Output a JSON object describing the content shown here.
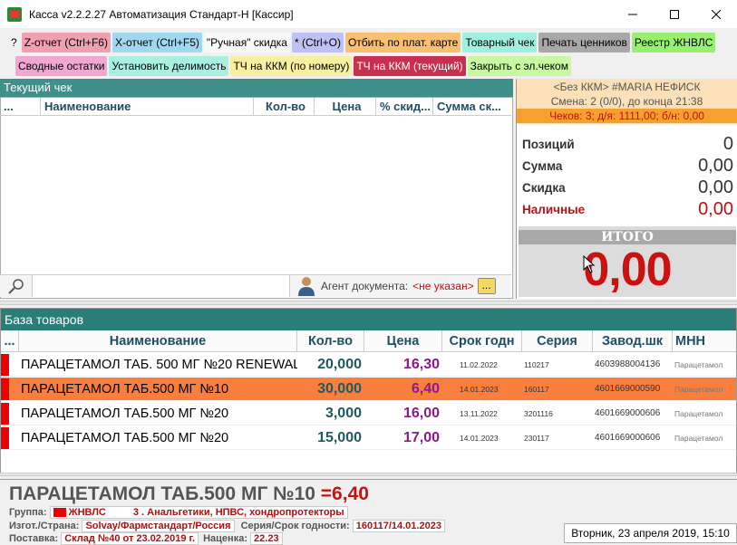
{
  "window": {
    "title": "Касса v2.2.2.27 Автоматизация Стандарт-Н [Кассир]",
    "min": "—",
    "max": "☐",
    "close": "✕"
  },
  "toolbar": {
    "row1": [
      {
        "label": "?",
        "color": "#f0f0f0"
      },
      {
        "label": "Z-отчет (Ctrl+F6)",
        "color": "#f0a0b0"
      },
      {
        "label": "X-отчет (Ctrl+F5)",
        "color": "#a0d8f0"
      },
      {
        "label": "\"Ручная\" скидка",
        "color": "#f8f8f8"
      },
      {
        "label": "* (Ctrl+O)",
        "color": "#c0c0f8"
      },
      {
        "label": "Отбить по плат. карте",
        "color": "#f8c070"
      },
      {
        "label": "Товарный чек",
        "color": "#a0f0e0"
      },
      {
        "label": "Печать ценников",
        "color": "#a8a8a8"
      },
      {
        "label": "Реестр ЖНВЛС",
        "color": "#98f070"
      }
    ],
    "row2": [
      {
        "label": "Сводные остатки",
        "color": "#f0a8d0"
      },
      {
        "label": "Установить делимость",
        "color": "#a8f0e0"
      },
      {
        "label": "ТЧ на ККМ (по номеру)",
        "color": "#f8f0a0"
      },
      {
        "label": "ТЧ на ККМ (текущий)",
        "color": "#c83050"
      },
      {
        "label": "Закрыть с эл.чеком",
        "color": "#c8f8a0"
      }
    ]
  },
  "receipt": {
    "title": "Текущий чек",
    "columns": [
      "...",
      "Наименование",
      "Кол-во",
      "Цена",
      "% скид...",
      "Сумма ск..."
    ],
    "agent_label": "Агент документа:",
    "agent_value": "<не указан>",
    "agent_button": "..."
  },
  "session": {
    "kkm": "<Без ККМ> #MARIA НЕФИСК",
    "shift": "Смена: 2 (0/0), до конца 21:38",
    "checks": "Чеков: 3; д/я: 1111,00; б/н: 0,00"
  },
  "totals": [
    {
      "label": "Позиций",
      "value": "0"
    },
    {
      "label": "Сумма",
      "value": "0,00"
    },
    {
      "label": "Скидка",
      "value": "0,00"
    },
    {
      "label": "Наличные",
      "value": "0,00"
    }
  ],
  "itogo": {
    "label": "ИТОГО",
    "value": "0,00"
  },
  "base": {
    "title": "База товаров",
    "columns": [
      "...",
      "Наименование",
      "Кол-во",
      "Цена",
      "Срок годн",
      "Серия",
      "Завод.шк",
      "МНН"
    ],
    "rows": [
      {
        "name": "ПАРАЦЕТАМОЛ ТАБ. 500 МГ №20 RENEWAL",
        "qty": "20,000",
        "price": "16,30",
        "exp": "11.02.2022",
        "series": "110217",
        "barcode": "4603988004136",
        "mnn": "Парацетамол"
      },
      {
        "name": "ПАРАЦЕТАМОЛ ТАБ.500 МГ №10",
        "qty": "30,000",
        "price": "6,40",
        "exp": "14.01.2023",
        "series": "160117",
        "barcode": "4601669000590",
        "mnn": "Парацетамол"
      },
      {
        "name": "ПАРАЦЕТАМОЛ ТАБ.500 МГ №20",
        "qty": "3,000",
        "price": "16,00",
        "exp": "13.11.2022",
        "series": "3201116",
        "barcode": "4601669000606",
        "mnn": "Парацетамол"
      },
      {
        "name": "ПАРАЦЕТАМОЛ ТАБ.500 МГ №20",
        "qty": "15,000",
        "price": "17,00",
        "exp": "14.01.2023",
        "series": "230117",
        "barcode": "4601669000606",
        "mnn": "Парацетамол"
      }
    ]
  },
  "details": {
    "name": "ПАРАЦЕТАМОЛ ТАБ.500 МГ №10",
    "price": "=6,40",
    "group_label": "Группа:",
    "group_code": "ЖНВЛС",
    "group_num": "3",
    "group_value": ". Анальгетики, НПВС, хондропротекторы",
    "maker_label": "Изгот./Страна:",
    "maker_value": "Solvay/Фармстандарт/Россия",
    "series_label": "Серия/Срок годности:",
    "series_value": "160117/14.01.2023",
    "supply_label": "Поставка:",
    "supply_value": "Склад №40 от 23.02.2019 г.",
    "markup_label": "Наценка:",
    "markup_value": "22.23",
    "date": "Вторник, 23 апреля 2019, 15:10"
  }
}
